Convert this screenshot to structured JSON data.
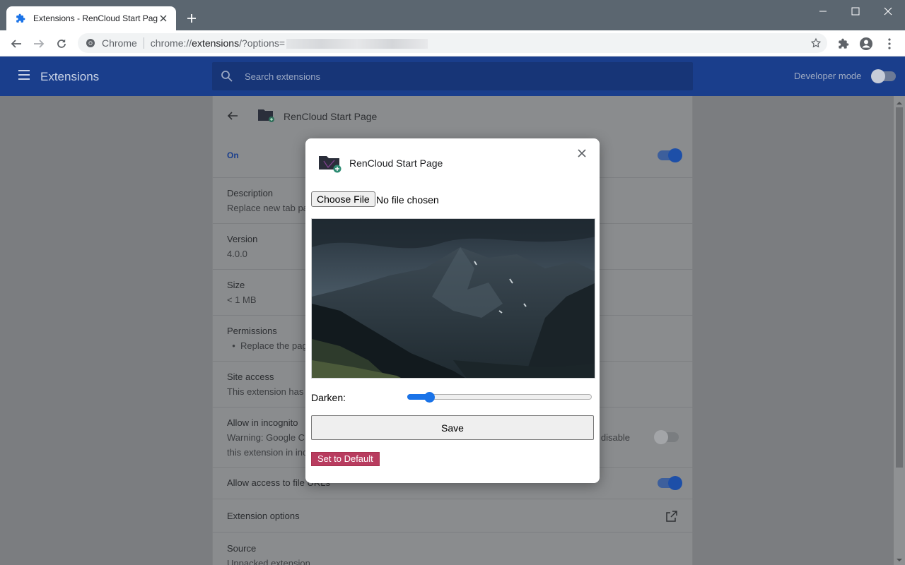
{
  "browser": {
    "tab_title": "Extensions - RenCloud Start Page",
    "omnibox_chip": "Chrome",
    "url_scheme": "chrome://",
    "url_host": "extensions",
    "url_path": "/?options="
  },
  "header": {
    "title": "Extensions",
    "search_placeholder": "Search extensions",
    "developer_mode_label": "Developer mode",
    "developer_mode_on": false
  },
  "details": {
    "extension_name": "RenCloud Start Page",
    "on_label": "On",
    "description_label": "Description",
    "description_value": "Replace new tab pa",
    "version_label": "Version",
    "version_value": "4.0.0",
    "size_label": "Size",
    "size_value": "< 1 MB",
    "permissions_label": "Permissions",
    "permissions_value": "Replace the pag",
    "site_access_label": "Site access",
    "site_access_value": "This extension has",
    "incognito_label": "Allow in incognito",
    "incognito_warning_line1": "Warning: Google Ch",
    "incognito_warning_right": "o disable",
    "incognito_warning_line2": "this extension in inc",
    "file_urls_label": "Allow access to file URLs",
    "options_label": "Extension options",
    "source_label": "Source",
    "source_value": "Unpacked extension"
  },
  "dialog": {
    "title": "RenCloud Start Page",
    "choose_file_label": "Choose File",
    "file_status": "No file chosen",
    "darken_label": "Darken:",
    "darken_value": 0.12,
    "save_label": "Save",
    "default_label": "Set to Default"
  },
  "colors": {
    "header_bg": "#1a3e8c",
    "accent": "#1a73e8",
    "default_button": "#b83c5f"
  }
}
